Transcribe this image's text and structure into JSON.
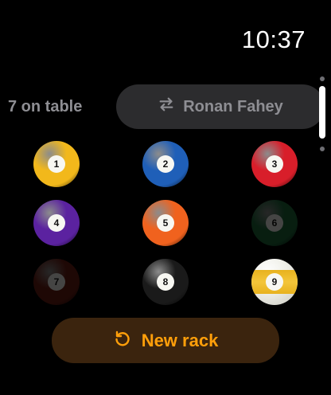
{
  "status": {
    "time": "10:37"
  },
  "header": {
    "count_label": "7 on table",
    "player_name": "Ronan Fahey"
  },
  "balls": [
    {
      "number": "1",
      "color": "#f2b81b",
      "pocketed": false,
      "stripe": false
    },
    {
      "number": "2",
      "color": "#1f5fb8",
      "pocketed": false,
      "stripe": false
    },
    {
      "number": "3",
      "color": "#d81e2a",
      "pocketed": false,
      "stripe": false
    },
    {
      "number": "4",
      "color": "#5b22a0",
      "pocketed": false,
      "stripe": false
    },
    {
      "number": "5",
      "color": "#f0621e",
      "pocketed": false,
      "stripe": false
    },
    {
      "number": "6",
      "color": "#1d6b3c",
      "pocketed": true,
      "stripe": false
    },
    {
      "number": "7",
      "color": "#6e1e14",
      "pocketed": true,
      "stripe": false
    },
    {
      "number": "8",
      "color": "#1a1a1a",
      "pocketed": false,
      "stripe": false
    },
    {
      "number": "9",
      "color": "#e8b21e",
      "pocketed": false,
      "stripe": true
    }
  ],
  "actions": {
    "new_rack_label": "New rack"
  },
  "colors": {
    "accent": "#ff9f0a",
    "button_bg": "#2c2c2e"
  }
}
